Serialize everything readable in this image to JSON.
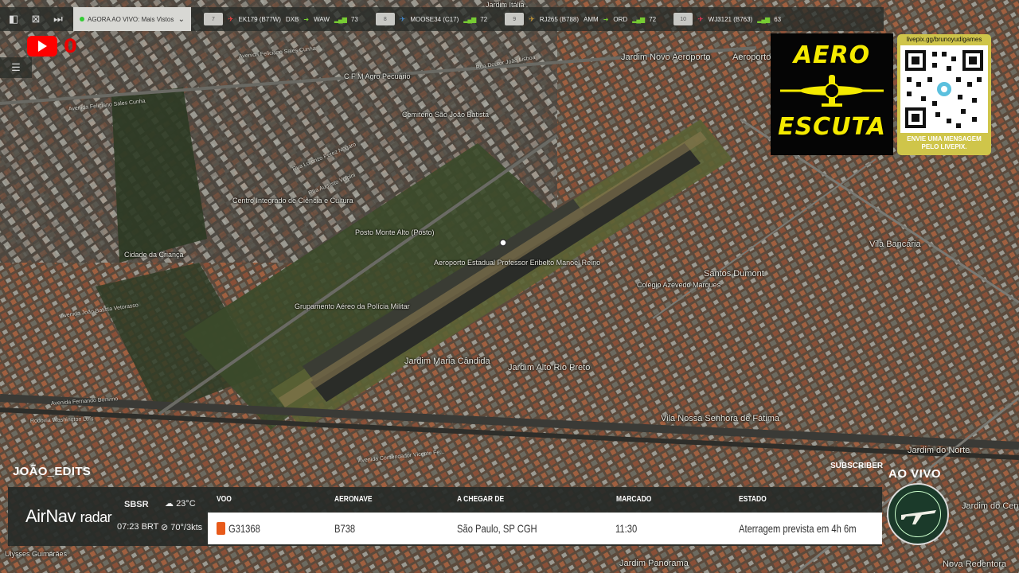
{
  "topbar": {
    "live_label": "AGORA AO VIVO: Mais Vistos",
    "flights": [
      {
        "num": "7",
        "callsign": "EK179 (B77W)",
        "from": "DXB",
        "to": "WAW",
        "signal": "73"
      },
      {
        "num": "8",
        "callsign": "MOOSE34 (C17)",
        "from": "",
        "to": "",
        "signal": "72"
      },
      {
        "num": "9",
        "callsign": "RJ265 (B788)",
        "from": "AMM",
        "to": "ORD",
        "signal": "72"
      },
      {
        "num": "10",
        "callsign": "WJ3121 (B763)",
        "from": "",
        "to": "",
        "signal": "63"
      }
    ]
  },
  "youtube": {
    "count": "0"
  },
  "aero_logo": {
    "line1": "AERO",
    "line2": "ESCUTA"
  },
  "qr": {
    "url": "livepix.gg/brunoyudigames",
    "caption_1": "ENVIE UMA MENSAGEM",
    "caption_2": "PELO LIVEPIX."
  },
  "map": {
    "labels": [
      "Jardim Novo Aeroporto",
      "Aeroporto",
      "Cemitério São João Batista",
      "C F M Agro Pecuário",
      "Centro Integrado de Ciência e Cultura",
      "Posto Monte Alto (Posto)",
      "Aeroporto Estadual Professor Eribelto Manoel Reino",
      "Cidade da Criança",
      "Grupamento Aéreo da Polícia Militar",
      "Vila Bancária",
      "Santos Dumont",
      "Colégio Azevedo Marques",
      "Jardim Maria Cândida",
      "Jardim Alto Rio Preto",
      "Vila Nossa Senhora de Fátima",
      "Jardim do Norte",
      "Jardim do Centro",
      "Jardim Panorama",
      "Nova Redentora",
      "Ulysses Guimarães",
      "Jardim Itália"
    ],
    "streets": [
      "Avenida Feliciano Sales Cunha",
      "Rua Doutor João Lisboa",
      "Rua Lorenzo Perez Nogaro",
      "Rua Augusto Volpini",
      "Avenida João Batista Vetorasso",
      "Avenida Fernando Bonvino",
      "Rodovia Washington Luís",
      "Avenida Feliciano Sales Cunha",
      "Avenida Comendador Vicente Fe..."
    ]
  },
  "panel": {
    "channel": "JOÃO_EDITS",
    "subscriber": "SUBSCRIBER",
    "logo_airnav": "AirNav",
    "logo_radar": "radar",
    "station": "SBSR",
    "time": "07:23 BRT",
    "temp": "23°C",
    "wind": "70°/3kts",
    "headers": {
      "voo": "VOO",
      "aeronave": "AERONAVE",
      "origem": "A CHEGAR DE",
      "marcado": "MARCADO",
      "estado": "ESTADO"
    },
    "row": {
      "voo": "G31368",
      "aeronave": "B738",
      "origem": "São Paulo, SP CGH",
      "marcado": "11:30",
      "estado": "Aterragem prevista em 4h 6m"
    }
  },
  "badge": {
    "live": "AO VIVO"
  },
  "colors": {
    "accent_yellow": "#f4ea00",
    "youtube_red": "#ff0000",
    "signal_green": "#77cc33",
    "flag_orange": "#e85a1a"
  }
}
